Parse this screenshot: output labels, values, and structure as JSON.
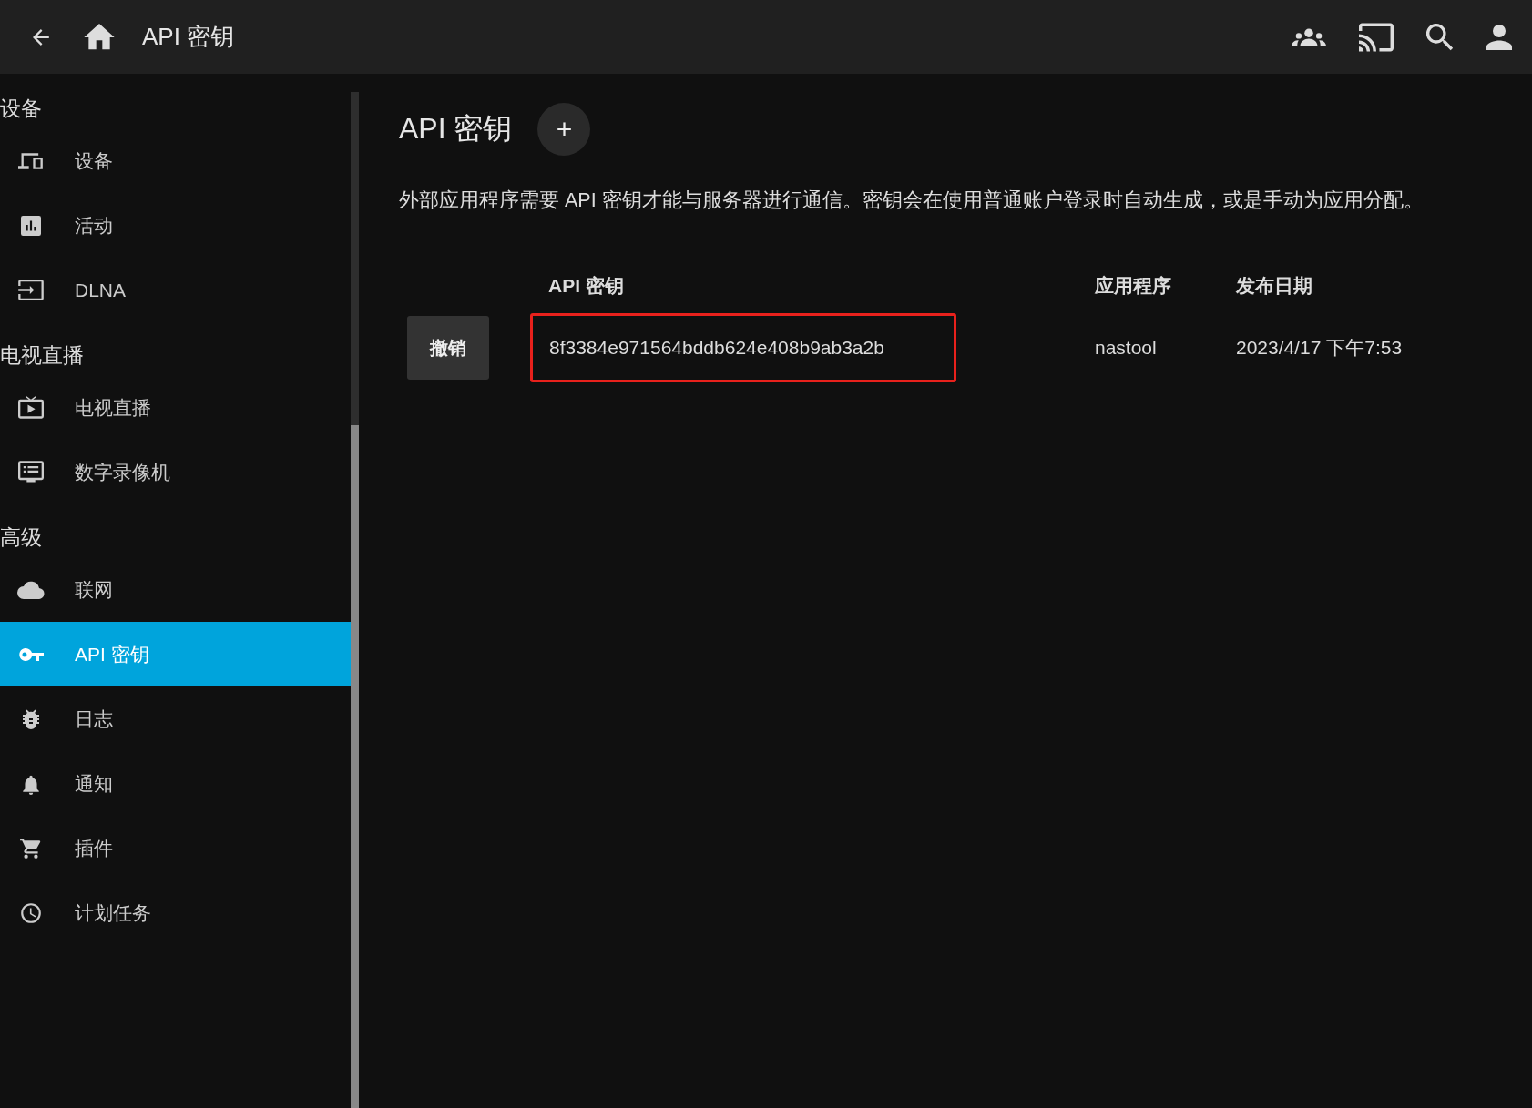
{
  "header": {
    "title": "API 密钥"
  },
  "sidebar": {
    "sections": [
      {
        "title": "设备",
        "items": [
          {
            "label": "设备",
            "selected": false
          },
          {
            "label": "活动",
            "selected": false
          },
          {
            "label": "DLNA",
            "selected": false
          }
        ]
      },
      {
        "title": "电视直播",
        "items": [
          {
            "label": "电视直播",
            "selected": false
          },
          {
            "label": "数字录像机",
            "selected": false
          }
        ]
      },
      {
        "title": "高级",
        "items": [
          {
            "label": "联网",
            "selected": false
          },
          {
            "label": "API 密钥",
            "selected": true
          },
          {
            "label": "日志",
            "selected": false
          },
          {
            "label": "通知",
            "selected": false
          },
          {
            "label": "插件",
            "selected": false
          },
          {
            "label": "计划任务",
            "selected": false
          }
        ]
      }
    ]
  },
  "page": {
    "title": "API 密钥",
    "add_button": "+",
    "description": "外部应用程序需要 API 密钥才能与服务器进行通信。密钥会在使用普通账户登录时自动生成，或是手动为应用分配。"
  },
  "table": {
    "columns": [
      "API 密钥",
      "应用程序",
      "发布日期"
    ],
    "rows": [
      {
        "action": "撤销",
        "key": "8f3384e971564bddb624e408b9ab3a2b",
        "app": "nastool",
        "date": "2023/4/17 下午7:53",
        "highlighted": true
      }
    ]
  }
}
